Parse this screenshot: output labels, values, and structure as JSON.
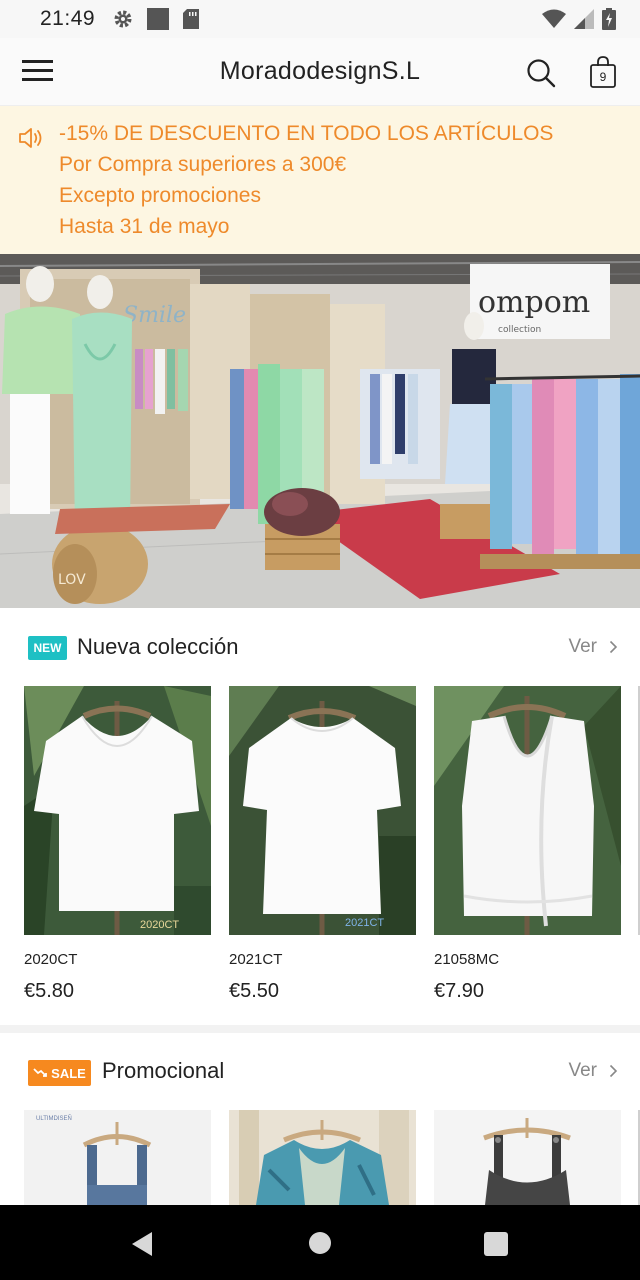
{
  "status_bar": {
    "time": "21:49",
    "icons": [
      "gear-icon",
      "square-icon",
      "sd-card-icon"
    ],
    "right_icons": [
      "wifi-icon",
      "signal-icon",
      "battery-icon"
    ]
  },
  "header": {
    "title": "MoradodesignS.L",
    "cart_count": "9"
  },
  "announcement": {
    "lines": [
      "-15% DE DESCUENTO EN TODO LOS ARTÍCULOS",
      "Por Compra superiores a 300€",
      "Excepto promociones",
      "Hasta 31 de mayo"
    ]
  },
  "sections": [
    {
      "badge": "NEW",
      "title": "Nueva colección",
      "see_more": "Ver",
      "products": [
        {
          "code": "2020CT",
          "price": "€5.80",
          "tag": "2020CT"
        },
        {
          "code": "2021CT",
          "price": "€5.50",
          "tag": "2021CT"
        },
        {
          "code": "21058MC",
          "price": "€7.90",
          "tag": ""
        }
      ]
    },
    {
      "badge": "SALE",
      "title": "Promocional",
      "see_more": "Ver",
      "products": [
        {
          "code": "",
          "price": "",
          "tag": "ULTIMDISEÑ"
        },
        {
          "code": "",
          "price": "",
          "tag": ""
        },
        {
          "code": "",
          "price": "",
          "tag": ""
        }
      ]
    }
  ],
  "colors": {
    "accent": "#ee8a2b",
    "announce_bg": "#fdf6e2",
    "new_badge": "#1ec0c4",
    "sale_badge": "#f6891f"
  }
}
